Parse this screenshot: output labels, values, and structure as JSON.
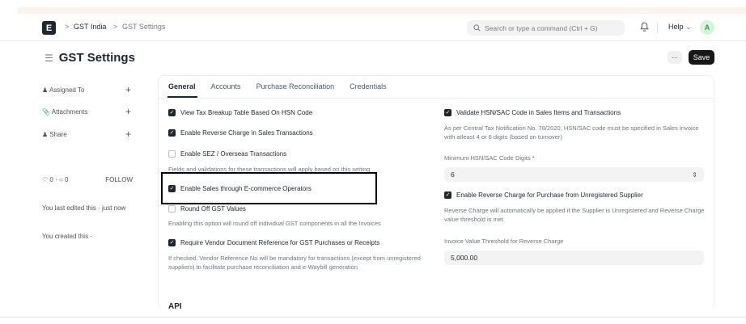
{
  "navbar": {
    "logo_letter": "E",
    "breadcrumbs": [
      "GST India",
      "GST Settings"
    ],
    "breadcrumb_sep": ">",
    "search_placeholder": "Search or type a command (Ctrl + G)",
    "help_label": "Help",
    "avatar_letter": "A"
  },
  "page": {
    "title": "GST Settings",
    "more_label": "···",
    "save_label": "Save"
  },
  "sidebar": {
    "assigned_to": "Assigned To",
    "attachments": "Attachments",
    "share": "Share",
    "plus": "+",
    "likes": "0",
    "comments": "0",
    "follow": "FOLLOW",
    "last_edited": "You last edited this · just now",
    "created": "You created this ·"
  },
  "tabs": [
    "General",
    "Accounts",
    "Purchase Reconciliation",
    "Credentials"
  ],
  "left_column": {
    "view_tax_breakup": {
      "label": "View Tax Breakup Table Based On HSN Code",
      "checked": true
    },
    "enable_reverse_charge_sales": {
      "label": "Enable Reverse Charge in Sales Transactions",
      "checked": true
    },
    "enable_sez": {
      "label": "Enable SEZ / Overseas Transactions",
      "checked": false
    },
    "sez_desc": "Fields and validations for these transactions will apply based on this setting",
    "enable_ecommerce": {
      "label": "Enable Sales through E-commerce Operators",
      "checked": true
    },
    "round_off": {
      "label": "Round Off GST Values",
      "checked": false
    },
    "round_off_desc": "Enabling this option will round off individual GST components in all the Invoices",
    "require_vendor_ref": {
      "label": "Require Vendor Document Reference for GST Purchases or Receipts",
      "checked": true
    },
    "vendor_ref_desc": "If checked, Vendor Reference No will be mandatory for transactions (except from unregistered suppliers) to facilitate purchase reconciliation and e-Waybill generation"
  },
  "right_column": {
    "validate_hsn": {
      "label": "Validate HSN/SAC Code in Sales Items and Transactions",
      "checked": true
    },
    "validate_hsn_desc": "As per Central Tax Notification No. 78/2020, HSN/SAC code must be specified in Sales Invoice with atleast 4 or 6 digits (based on turnover)",
    "min_digits_label": "Minimum HSN/SAC Code Digits",
    "required_mark": "*",
    "min_digits_value": "6",
    "reverse_charge_purchase": {
      "label": "Enable Reverse Charge for Purchase from Unregistered Supplier",
      "checked": true
    },
    "reverse_charge_purchase_desc": "Reverse Charge will automatically be applied if the Supplier is Unregistered and Reverse Charge value threshold is met",
    "threshold_label": "Invoice Value Threshold for Reverse Charge",
    "threshold_value": "5,000.00"
  },
  "section_api": "API",
  "colors": {
    "primary": "#1f272e",
    "save_bg": "#171717",
    "highlight": "#000000"
  }
}
